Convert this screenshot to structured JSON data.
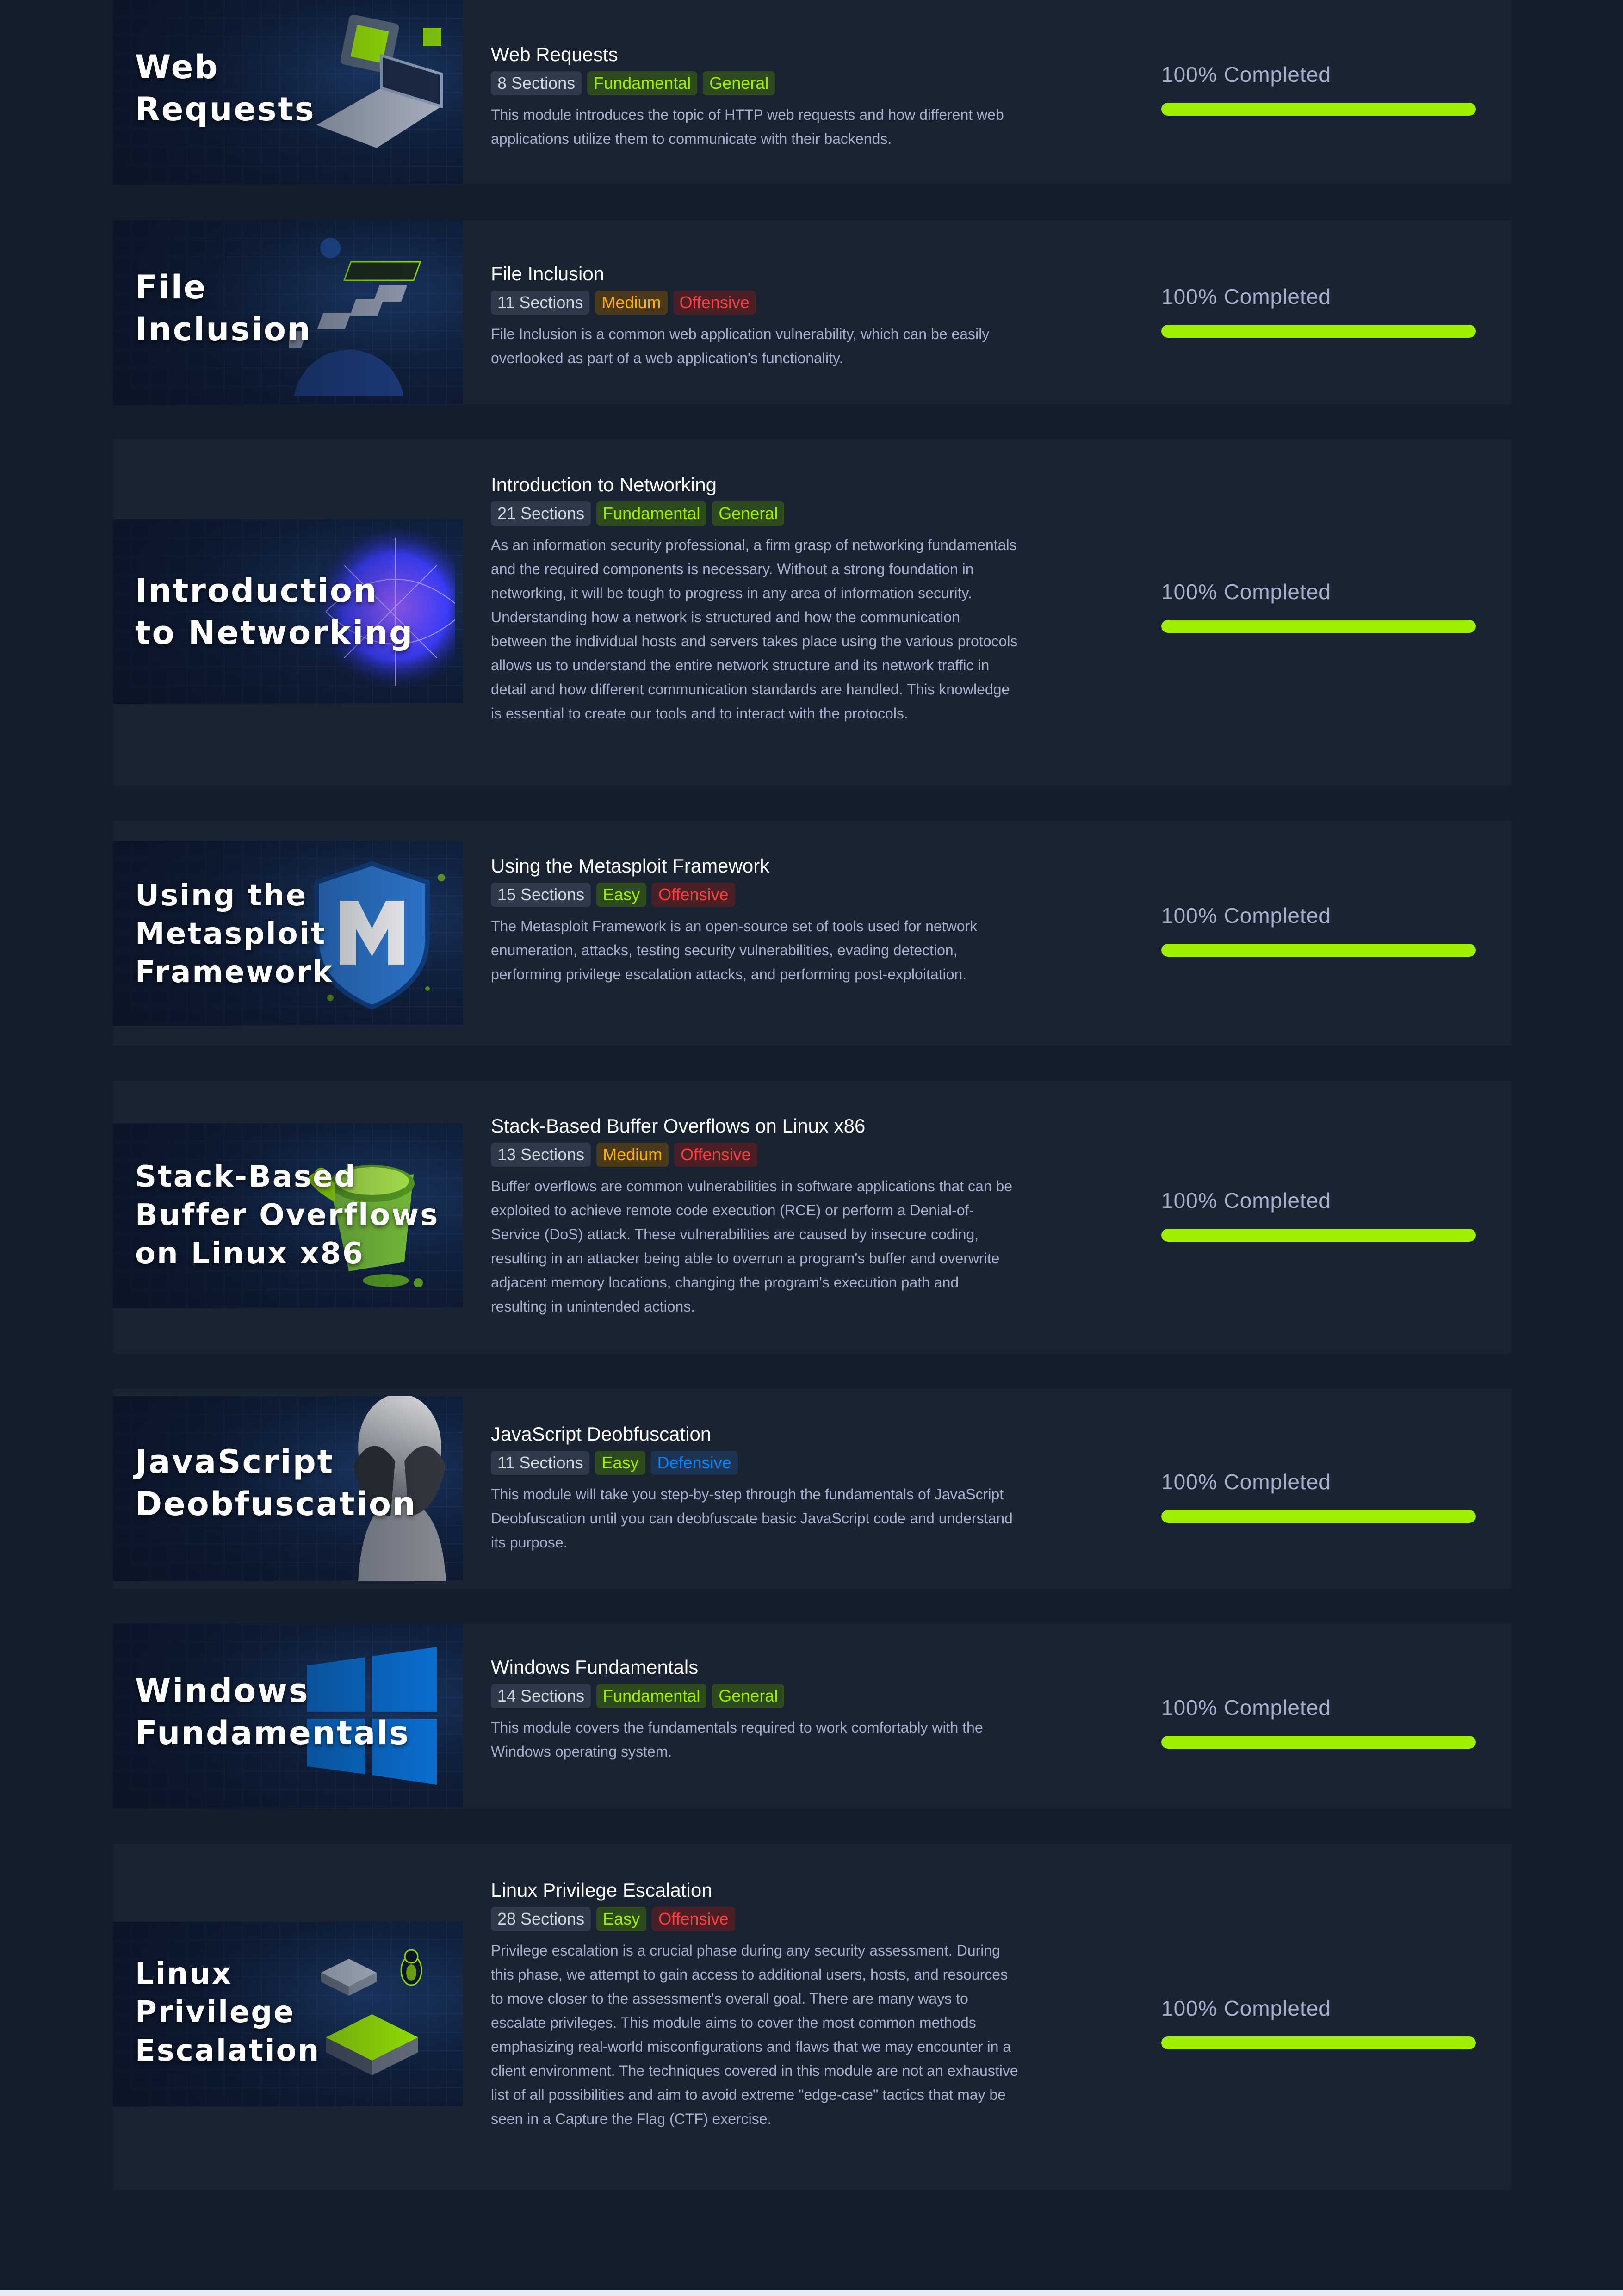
{
  "modules": [
    {
      "title": "Web Requests",
      "thumb_title": [
        "Web",
        "Requests"
      ],
      "sections": "8 Sections",
      "tags": [
        {
          "label": "Fundamental",
          "kind": "fundamental"
        },
        {
          "label": "General",
          "kind": "general"
        }
      ],
      "description": "This module introduces the topic of HTTP web requests and how different web applications utilize them to communicate with their backends.",
      "progress_label": "100% Completed",
      "progress": 1.0,
      "art": "laptop-cube-icon"
    },
    {
      "title": "File Inclusion",
      "thumb_title": [
        "File",
        "Inclusion"
      ],
      "sections": "11 Sections",
      "tags": [
        {
          "label": "Medium",
          "kind": "medium"
        },
        {
          "label": "Offensive",
          "kind": "offensive"
        }
      ],
      "description": "File Inclusion is a common web application vulnerability, which can be easily overlooked as part of a web application's functionality.",
      "progress_label": "100% Completed",
      "progress": 1.0,
      "art": "file-stack-icon"
    },
    {
      "title": "Introduction to Networking",
      "thumb_title": [
        "Introduction",
        "to Networking"
      ],
      "sections": "21 Sections",
      "tags": [
        {
          "label": "Fundamental",
          "kind": "fundamental"
        },
        {
          "label": "General",
          "kind": "general"
        }
      ],
      "description": "As an information security professional, a firm grasp of networking fundamentals and the required components is necessary. Without a strong foundation in networking, it will be tough to progress in any area of information security. Understanding how a network is structured and how the communication between the individual hosts and servers takes place using the various protocols allows us to understand the entire network structure and its network traffic in detail and how different communication standards are handled. This knowledge is essential to create our tools and to interact with the protocols.",
      "progress_label": "100% Completed",
      "progress": 1.0,
      "art": "network-globe-icon"
    },
    {
      "title": "Using the Metasploit Framework",
      "thumb_title": [
        "Using the",
        "Metasploit",
        "Framework"
      ],
      "sections": "15 Sections",
      "tags": [
        {
          "label": "Easy",
          "kind": "easy"
        },
        {
          "label": "Offensive",
          "kind": "offensive"
        }
      ],
      "description": "The Metasploit Framework is an open-source set of tools used for network enumeration, attacks, testing security vulnerabilities, evading detection, performing privilege escalation attacks, and performing post-exploitation.",
      "progress_label": "100% Completed",
      "progress": 1.0,
      "art": "metasploit-shield-icon"
    },
    {
      "title": "Stack-Based Buffer Overflows on Linux x86",
      "thumb_title": [
        "Stack-Based",
        "Buffer Overflows",
        "on Linux x86"
      ],
      "sections": "13 Sections",
      "tags": [
        {
          "label": "Medium",
          "kind": "medium"
        },
        {
          "label": "Offensive",
          "kind": "offensive"
        }
      ],
      "description": "Buffer overflows are common vulnerabilities in software applications that can be exploited to achieve remote code execution (RCE) or perform a Denial-of-Service (DoS) attack. These vulnerabilities are caused by insecure coding, resulting in an attacker being able to overrun a program's buffer and overwrite adjacent memory locations, changing the program's execution path and resulting in unintended actions.",
      "progress_label": "100% Completed",
      "progress": 1.0,
      "art": "overflowing-cup-icon"
    },
    {
      "title": "JavaScript Deobfuscation",
      "thumb_title": [
        "JavaScript",
        "Deobfuscation"
      ],
      "sections": "11 Sections",
      "tags": [
        {
          "label": "Easy",
          "kind": "easy"
        },
        {
          "label": "Defensive",
          "kind": "defensive"
        }
      ],
      "description": "This module will take you step-by-step through the fundamentals of JavaScript Deobfuscation until you can deobfuscate basic JavaScript code and understand its purpose.",
      "progress_label": "100% Completed",
      "progress": 1.0,
      "art": "covered-face-icon"
    },
    {
      "title": "Windows Fundamentals",
      "thumb_title": [
        "Windows",
        "Fundamentals"
      ],
      "sections": "14 Sections",
      "tags": [
        {
          "label": "Fundamental",
          "kind": "fundamental"
        },
        {
          "label": "General",
          "kind": "general"
        }
      ],
      "description": "This module covers the fundamentals required to work comfortably with the Windows operating system.",
      "progress_label": "100% Completed",
      "progress": 1.0,
      "art": "windows-logo-icon"
    },
    {
      "title": "Linux Privilege Escalation",
      "thumb_title": [
        "Linux",
        "Privilege",
        "Escalation"
      ],
      "sections": "28 Sections",
      "tags": [
        {
          "label": "Easy",
          "kind": "easy"
        },
        {
          "label": "Offensive",
          "kind": "offensive"
        }
      ],
      "description": "Privilege escalation is a crucial phase during any security assessment. During this phase, we attempt to gain access to additional users, hosts, and resources to move closer to the assessment's overall goal. There are many ways to escalate privileges. This module aims to cover the most common methods emphasizing real-world misconfigurations and flaws that we may encounter in a client environment. The techniques covered in this module are not an exhaustive list of all possibilities and aim to avoid extreme \"edge-case\" tactics that may be seen in a Capture the Flag (CTF) exercise.",
      "progress_label": "100% Completed",
      "progress": 1.0,
      "art": "linux-penguin-chip-icon"
    }
  ],
  "colors": {
    "page_bg": "#141d2b",
    "card_bg": "#1a2332",
    "accent_green": "#9fef00",
    "text_muted": "#a4b1cd"
  }
}
